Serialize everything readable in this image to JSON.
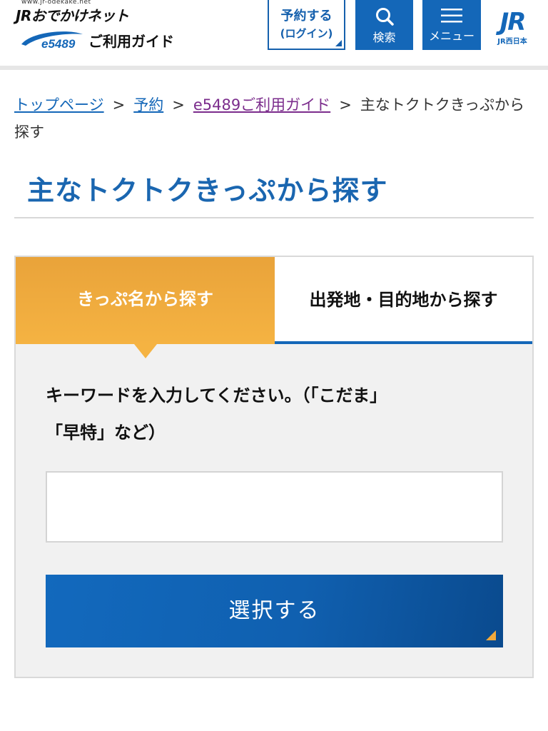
{
  "colors": {
    "brand_blue": "#1467b8",
    "title_blue": "#1a66b0",
    "tab_orange": "#f5b342",
    "panel_bg": "#f1f1f1",
    "visited_link": "#7b2c8c"
  },
  "header": {
    "site_url": "www.jr-odekake.net",
    "site_logo": "JRおでかけネット",
    "e5489_badge": "e5489",
    "guide_title": "ご利用ガイド",
    "reserve_button": {
      "line1": "予約する",
      "line2": "(ログイン)"
    },
    "search_button": {
      "label": "検索",
      "icon": "search-icon"
    },
    "menu_button": {
      "label": "メニュー",
      "icon": "hamburger-menu-icon"
    },
    "jr_logo": {
      "mark": "JR",
      "sub": "JR西日本"
    }
  },
  "breadcrumb": {
    "items": [
      {
        "label": "トップページ",
        "link": true
      },
      {
        "label": "予約",
        "link": true
      },
      {
        "label": "e5489ご利用ガイド",
        "link": true,
        "visited": true
      },
      {
        "label": "主なトクトクきっぷから探す",
        "link": false
      }
    ],
    "separator": ">"
  },
  "page": {
    "title": "主なトクトクきっぷから探す"
  },
  "search_panel": {
    "tabs": [
      {
        "label": "きっぷ名から探す",
        "active": true
      },
      {
        "label": "出発地・目的地から探す",
        "active": false
      }
    ],
    "instructions_line1": "キーワードを入力してください。（「こだま」",
    "instructions_line2": "「早特」など）",
    "keyword_input": {
      "value": "",
      "placeholder": ""
    },
    "submit_label": "選択する"
  }
}
